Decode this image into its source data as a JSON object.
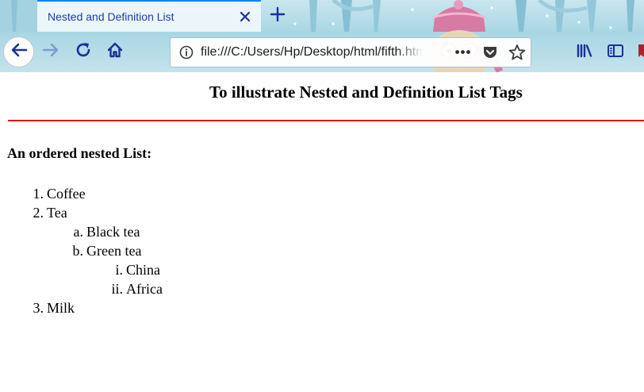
{
  "browser": {
    "tab_title": "Nested and Definition List",
    "url": "file:///C:/Users/Hp/Desktop/html/fifth.html",
    "icons": {
      "tab_close": "close-icon",
      "new_tab": "plus-icon",
      "back": "arrow-left-icon",
      "forward": "arrow-right-icon",
      "reload": "reload-icon",
      "home": "home-icon",
      "site_info": "info-icon",
      "page_actions": "ellipsis-icon",
      "pocket": "pocket-icon",
      "bookmark": "star-icon",
      "library": "library-icon",
      "sidebar": "sidebar-icon"
    },
    "page_actions_label": "•••",
    "accent_color": "#0a84ff",
    "icon_color": "#1a2f9c"
  },
  "page": {
    "title": "To illustrate Nested and Definition List Tags",
    "divider_color": "#e11414",
    "list_heading": "An ordered nested List:",
    "list": [
      {
        "marker": "1.",
        "text": "Coffee"
      },
      {
        "marker": "2.",
        "text": "Tea",
        "children": [
          {
            "marker": "a.",
            "text": "Black tea"
          },
          {
            "marker": "b.",
            "text": "Green tea",
            "children": [
              {
                "marker": "i.",
                "text": "China"
              },
              {
                "marker": "ii.",
                "text": "Africa"
              }
            ]
          }
        ]
      },
      {
        "marker": "3.",
        "text": "Milk"
      }
    ]
  }
}
